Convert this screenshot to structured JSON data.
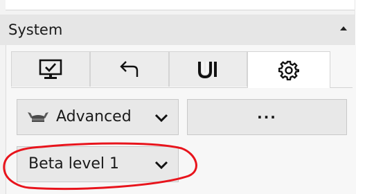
{
  "section": {
    "title": "System"
  },
  "tabs": [
    {
      "icon": "monitor-check-icon"
    },
    {
      "icon": "undo-arrow-icon"
    },
    {
      "icon": "ui-icon",
      "label": "UI"
    },
    {
      "icon": "gear-icon"
    }
  ],
  "mode_dropdown": {
    "icon": "viking-helmet-icon",
    "value": "Advanced"
  },
  "more_button": {
    "label": "···"
  },
  "level_dropdown": {
    "value": "Beta level 1"
  },
  "annotation": {
    "color": "#e8141c"
  }
}
